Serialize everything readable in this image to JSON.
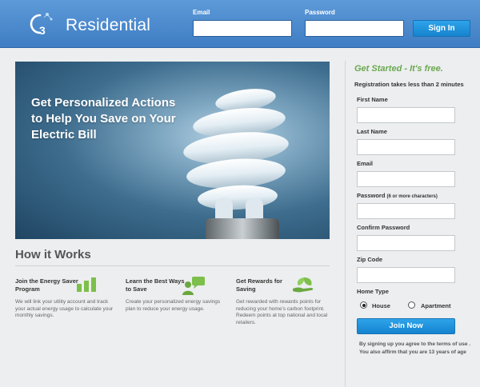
{
  "header": {
    "brand": "Residential",
    "email_label": "Email",
    "password_label": "Password",
    "email_value": "",
    "password_value": "",
    "signin_label": "Sign In",
    "logo_text": "C3"
  },
  "hero": {
    "title": "Get Personalized Actions to Help You Save on Your Electric Bill"
  },
  "how_it_works": {
    "title": "How it Works",
    "steps": [
      {
        "title": "Join the Energy Saver Program",
        "text": "We will link your utility account and track your actual energy usage to calculate your monthly savings.",
        "icon": "bar-chart-icon"
      },
      {
        "title": "Learn the Best Ways to Save",
        "text": "Create your personalized energy savings plan to reduce your energy usage.",
        "icon": "person-chat-icon"
      },
      {
        "title": "Get Rewards for Saving",
        "text": "Get rewarded with rewards points for reducing your home's carbon footprint. Redeem points at top national and local retailers.",
        "icon": "hand-leaf-icon"
      }
    ]
  },
  "signup": {
    "heading": "Get Started - It's free.",
    "subheading": "Registration takes less than 2 minutes",
    "first_name_label": "First Name",
    "last_name_label": "Last Name",
    "email_label": "Email",
    "password_label": "Password",
    "password_hint": "(6 or more characters)",
    "confirm_password_label": "Confirm Password",
    "zip_label": "Zip Code",
    "home_type_label": "Home Type",
    "home_type_options": [
      "House",
      "Apartment"
    ],
    "home_type_selected": "House",
    "join_label": "Join Now",
    "terms": "By signing up you agree to the terms of use . You also affirm that you are 13 years of age"
  },
  "colors": {
    "header_blue": "#4a89cf",
    "button_blue": "#1e90dd",
    "accent_green": "#6aa84f"
  }
}
